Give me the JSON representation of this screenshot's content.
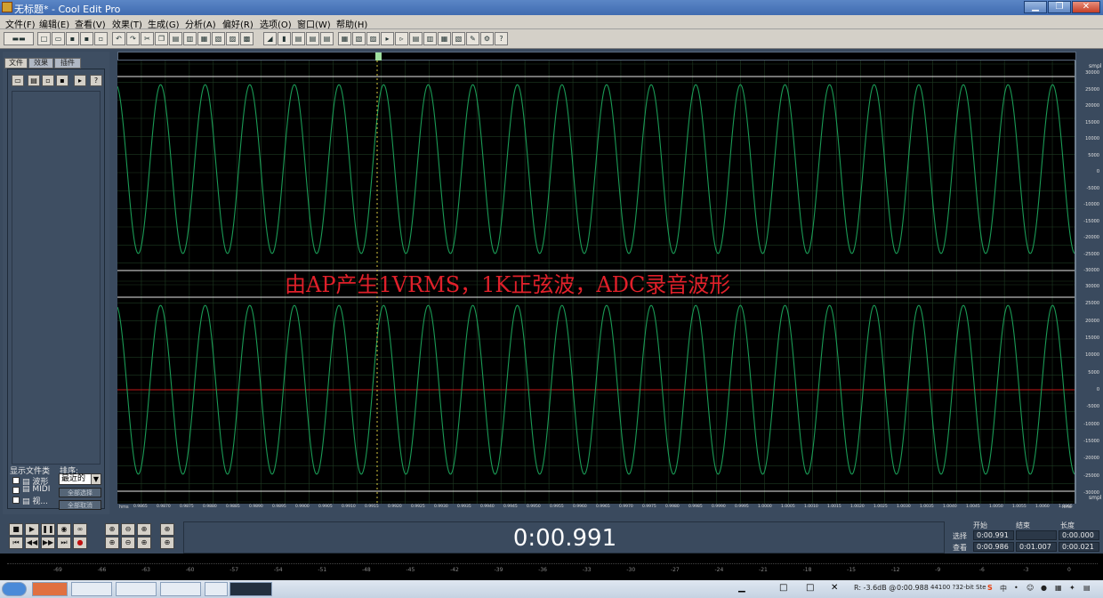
{
  "window": {
    "title": "无标题* - Cool Edit Pro",
    "controls": [
      "▁",
      "❐",
      "✕"
    ]
  },
  "menu": [
    "文件(F)",
    "编辑(E)",
    "查看(V)",
    "效果(T)",
    "生成(G)",
    "分析(A)",
    "偏好(R)",
    "选项(O)",
    "窗口(W)",
    "帮助(H)"
  ],
  "left_panel": {
    "tabs": [
      "文件",
      "效果",
      "插件"
    ],
    "show_files_label": "显示文件类",
    "sort_label": "排序:",
    "sort_value": "最近的",
    "file_types": [
      "波形",
      "MIDI",
      "视..."
    ],
    "buttons": [
      "全部选择",
      "全部取消"
    ]
  },
  "annotation": "由AP产生1VRMS，1K正弦波，ADC录音波形",
  "vertical_scale": {
    "unit": "smpl",
    "top_channel": [
      "30000",
      "25000",
      "20000",
      "15000",
      "10000",
      "5000",
      "0",
      "-5000",
      "-10000",
      "-15000",
      "-20000",
      "-25000",
      "-30000"
    ],
    "bottom_channel": [
      "30000",
      "25000",
      "20000",
      "15000",
      "10000",
      "5000",
      "0",
      "-5000",
      "-10000",
      "-15000",
      "-20000",
      "-25000",
      "-30000"
    ]
  },
  "time_ruler": {
    "start_label": "hms",
    "end_label": "hms",
    "ticks": [
      "0.9865",
      "0.9870",
      "0.9875",
      "0.9880",
      "0.9885",
      "0.9890",
      "0.9895",
      "0.9900",
      "0.9905",
      "0.9910",
      "0.9915",
      "0.9920",
      "0.9925",
      "0.9930",
      "0.9935",
      "0.9940",
      "0.9945",
      "0.9950",
      "0.9955",
      "0.9960",
      "0.9965",
      "0.9970",
      "0.9975",
      "0.9980",
      "0.9985",
      "0.9990",
      "0.9995",
      "1.0000",
      "1.0005",
      "1.0010",
      "1.0015",
      "1.0020",
      "1.0025",
      "1.0030",
      "1.0035",
      "1.0040",
      "1.0045",
      "1.0050",
      "1.0055",
      "1.0060",
      "1.0065"
    ]
  },
  "transport": {
    "row1": [
      "■",
      "▶",
      "❚❚",
      "◉",
      "∞"
    ],
    "row2": [
      "⏮",
      "◀◀",
      "▶▶",
      "⏭",
      "●"
    ],
    "zoom_row1": [
      "⊕",
      "⊖",
      "⊕",
      "⊕"
    ],
    "zoom_row2": [
      "⊕",
      "⊖",
      "⊕",
      "⊕"
    ]
  },
  "current_time": "0:00.991",
  "selection_panel": {
    "headers": [
      "开始",
      "结束",
      "长度"
    ],
    "row_labels": [
      "选择",
      "查看"
    ],
    "selection": [
      "0:00.991",
      "",
      "0:00.000"
    ],
    "view": [
      "0:00.986",
      "0:01.007",
      "0:00.021"
    ]
  },
  "meter_ticks": [
    "-69",
    "-66",
    "-63",
    "-60",
    "-57",
    "-54",
    "-51",
    "-48",
    "-45",
    "-42",
    "-39",
    "-36",
    "-33",
    "-30",
    "-27",
    "-24",
    "-21",
    "-18",
    "-15",
    "-12",
    "-9",
    "-6",
    "-3",
    "0"
  ],
  "status": {
    "level": "R: -3.6dB @",
    "time": "0:00.988",
    "format": "44100 ?32-bit Ste"
  },
  "waveform": {
    "cycles": 21.5,
    "amplitude": 24500,
    "y_max": 32768,
    "wave_color": "#1a9a55",
    "center_color": "#c01818",
    "grid_color": "#1e3a22",
    "cursor_color": "#d8c840"
  }
}
